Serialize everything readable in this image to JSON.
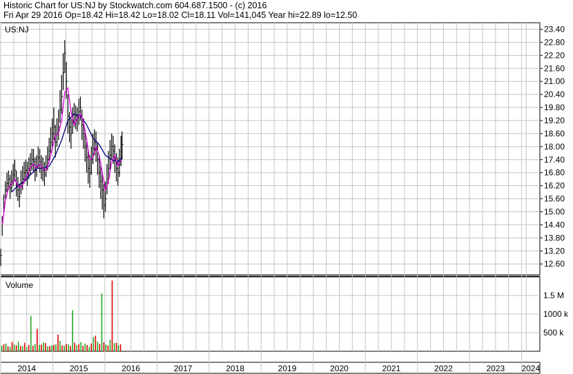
{
  "header": {
    "line1": "Historic Chart for US:NJ by Stockwatch.com 604.687.1500 - (c) 2016",
    "line2": "Fri Apr 29 2016   Op=18.42   Hi=18.42   Lo=18.02   Cl=18.11   Vol=141,045   Year hi=22.89   lo=12.50"
  },
  "colors": {
    "grid": "#c4c4c4",
    "price_bar": "#000000",
    "ma_short": "#dd00dd",
    "ma_long": "#000080",
    "volume_up": "#22aa22",
    "volume_down": "#dd0000"
  },
  "chart_data": [
    {
      "type": "line",
      "subtype": "ohlc-with-moving-averages",
      "title": "US:NJ",
      "y_ticks": [
        "23.40",
        "22.80",
        "22.20",
        "21.60",
        "21.00",
        "20.40",
        "19.80",
        "19.20",
        "18.60",
        "18.00",
        "17.40",
        "16.80",
        "16.20",
        "15.60",
        "15.00",
        "14.40",
        "13.80",
        "13.20",
        "12.60"
      ],
      "ylim": [
        12.1,
        23.7
      ],
      "xlim": [
        2014.0,
        2024.35
      ],
      "grid": true,
      "series": [
        {
          "style": "price-bars",
          "x": [
            2014.0,
            2014.03,
            2014.06,
            2014.09,
            2014.12,
            2014.15,
            2014.18,
            2014.21,
            2014.24,
            2014.27,
            2014.3,
            2014.33,
            2014.36,
            2014.39,
            2014.42,
            2014.45,
            2014.48,
            2014.51,
            2014.54,
            2014.57,
            2014.6,
            2014.63,
            2014.66,
            2014.69,
            2014.72,
            2014.75,
            2014.78,
            2014.81,
            2014.84,
            2014.87,
            2014.9,
            2014.93,
            2014.96,
            2014.99,
            2015.02,
            2015.05,
            2015.08,
            2015.11,
            2015.14,
            2015.17,
            2015.2,
            2015.23,
            2015.26,
            2015.29,
            2015.32,
            2015.35,
            2015.38,
            2015.41,
            2015.44,
            2015.47,
            2015.5,
            2015.53,
            2015.56,
            2015.59,
            2015.62,
            2015.65,
            2015.68,
            2015.71,
            2015.74,
            2015.77,
            2015.8,
            2015.83,
            2015.86,
            2015.89,
            2015.92,
            2015.95,
            2015.98,
            2016.01,
            2016.04,
            2016.07,
            2016.1,
            2016.13,
            2016.16,
            2016.19,
            2016.22,
            2016.25,
            2016.28,
            2016.31,
            2016.33
          ],
          "values": [
            13.0,
            14.5,
            15.4,
            16.0,
            16.3,
            16.5,
            16.1,
            16.4,
            16.7,
            16.9,
            16.2,
            16.0,
            15.7,
            16.3,
            16.5,
            16.8,
            16.9,
            16.7,
            17.0,
            17.2,
            17.4,
            17.3,
            16.9,
            17.1,
            17.5,
            17.3,
            17.0,
            16.9,
            16.7,
            17.1,
            17.4,
            17.8,
            18.2,
            18.6,
            18.9,
            18.2,
            18.6,
            18.9,
            19.7,
            20.3,
            21.4,
            22.3,
            21.0,
            19.4,
            18.9,
            18.6,
            19.2,
            19.5,
            19.4,
            19.3,
            19.6,
            19.8,
            19.0,
            18.6,
            18.0,
            17.5,
            17.0,
            16.8,
            17.4,
            17.9,
            18.2,
            18.0,
            17.4,
            16.8,
            16.4,
            16.0,
            15.3,
            15.6,
            16.5,
            17.0,
            17.6,
            18.0,
            17.8,
            17.4,
            17.0,
            16.8,
            17.2,
            17.8,
            18.1
          ],
          "high": [
            13.3,
            14.8,
            15.8,
            16.4,
            16.8,
            16.9,
            16.7,
            16.9,
            17.2,
            17.4,
            16.9,
            16.6,
            16.3,
            16.9,
            17.1,
            17.3,
            17.4,
            17.3,
            17.5,
            17.7,
            17.9,
            17.9,
            17.5,
            17.6,
            18.0,
            17.9,
            17.6,
            17.5,
            17.3,
            17.6,
            18.0,
            18.4,
            18.9,
            19.3,
            19.8,
            19.0,
            19.3,
            19.7,
            20.6,
            21.3,
            22.3,
            22.9,
            21.9,
            20.4,
            19.6,
            19.3,
            19.8,
            20.0,
            19.9,
            19.8,
            20.2,
            20.3,
            19.7,
            19.3,
            18.8,
            18.4,
            17.8,
            17.6,
            18.0,
            18.6,
            18.8,
            18.7,
            18.2,
            17.6,
            17.3,
            16.8,
            16.3,
            16.4,
            17.2,
            17.8,
            18.3,
            18.6,
            18.5,
            18.1,
            17.7,
            17.5,
            17.9,
            18.5,
            18.7
          ],
          "low": [
            12.5,
            13.9,
            15.0,
            15.6,
            15.9,
            16.0,
            15.6,
            15.9,
            16.2,
            16.4,
            15.7,
            15.5,
            15.2,
            15.8,
            16.0,
            16.3,
            16.4,
            16.2,
            16.5,
            16.7,
            16.9,
            16.8,
            16.4,
            16.6,
            17.0,
            16.8,
            16.5,
            16.4,
            16.2,
            16.6,
            16.9,
            17.3,
            17.6,
            18.0,
            18.3,
            17.5,
            18.0,
            18.3,
            19.1,
            19.5,
            20.6,
            21.4,
            20.2,
            18.6,
            18.2,
            17.9,
            18.6,
            18.9,
            18.8,
            18.7,
            19.0,
            19.2,
            18.3,
            17.9,
            17.3,
            16.8,
            16.3,
            16.1,
            16.7,
            17.2,
            17.6,
            17.3,
            16.7,
            16.1,
            15.6,
            15.1,
            14.7,
            15.0,
            15.8,
            16.3,
            16.9,
            17.4,
            17.2,
            16.8,
            16.4,
            16.2,
            16.6,
            17.1,
            17.4
          ]
        },
        {
          "style": "moving-average-short",
          "x": [
            2014.03,
            2014.09,
            2014.15,
            2014.21,
            2014.27,
            2014.33,
            2014.39,
            2014.45,
            2014.51,
            2014.57,
            2014.63,
            2014.69,
            2014.75,
            2014.81,
            2014.87,
            2014.93,
            2014.99,
            2015.05,
            2015.11,
            2015.17,
            2015.23,
            2015.29,
            2015.35,
            2015.41,
            2015.47,
            2015.53,
            2015.59,
            2015.65,
            2015.71,
            2015.77,
            2015.83,
            2015.89,
            2015.95,
            2016.01,
            2016.07,
            2016.13,
            2016.19,
            2016.25,
            2016.31
          ],
          "values": [
            14.4,
            15.5,
            16.1,
            16.3,
            16.5,
            16.2,
            16.1,
            16.4,
            16.7,
            17.0,
            17.2,
            17.0,
            17.2,
            17.0,
            16.9,
            17.3,
            17.9,
            18.5,
            18.6,
            19.2,
            20.5,
            20.7,
            19.6,
            19.0,
            19.3,
            19.5,
            19.1,
            18.3,
            17.4,
            17.5,
            18.0,
            17.6,
            16.8,
            16.0,
            16.4,
            17.3,
            17.6,
            17.1,
            17.4
          ]
        },
        {
          "style": "moving-average-long",
          "x": [
            2014.21,
            2014.33,
            2014.45,
            2014.57,
            2014.69,
            2014.81,
            2014.93,
            2015.05,
            2015.17,
            2015.29,
            2015.41,
            2015.53,
            2015.65,
            2015.77,
            2015.89,
            2016.01,
            2016.13,
            2016.25,
            2016.33
          ],
          "values": [
            15.9,
            16.2,
            16.4,
            16.7,
            17.0,
            17.0,
            17.1,
            17.6,
            18.3,
            19.2,
            19.5,
            19.4,
            19.0,
            18.4,
            18.1,
            17.6,
            17.4,
            17.3,
            17.5
          ]
        }
      ]
    },
    {
      "type": "bar",
      "title": "Volume",
      "y_ticks": [
        "1.5 M",
        "1000 k",
        "500 k"
      ],
      "y_tick_values": [
        1500000,
        1000000,
        500000
      ],
      "ylim": [
        0,
        2000000
      ],
      "xlim": [
        2014.0,
        2024.35
      ],
      "x_tick_labels": [
        "2014",
        "2015",
        "2016",
        "2017",
        "2018",
        "2019",
        "2020",
        "2021",
        "2022",
        "2023",
        "2024"
      ],
      "x_tick_values": [
        2014,
        2015,
        2016,
        2017,
        2018,
        2019,
        2020,
        2021,
        2022,
        2023,
        2024
      ],
      "grid": true,
      "up_x": [
        2014.02,
        2014.1,
        2014.18,
        2014.26,
        2014.34,
        2014.42,
        2014.5,
        2014.58,
        2014.66,
        2014.74,
        2014.82,
        2014.9,
        2014.98,
        2015.06,
        2015.14,
        2015.22,
        2015.3,
        2015.38,
        2015.46,
        2015.54,
        2015.62,
        2015.7,
        2015.78,
        2015.86,
        2015.94,
        2016.02,
        2016.1,
        2016.18,
        2016.26
      ],
      "up_values": [
        150000,
        210000,
        120000,
        180000,
        260000,
        140000,
        110000,
        950000,
        200000,
        170000,
        240000,
        130000,
        160000,
        190000,
        280000,
        150000,
        180000,
        1100000,
        170000,
        250000,
        210000,
        120000,
        380000,
        260000,
        1550000,
        180000,
        310000,
        220000,
        160000
      ],
      "down_x": [
        2014.06,
        2014.14,
        2014.22,
        2014.3,
        2014.38,
        2014.46,
        2014.54,
        2014.62,
        2014.7,
        2014.78,
        2014.86,
        2014.94,
        2015.02,
        2015.1,
        2015.18,
        2015.26,
        2015.34,
        2015.42,
        2015.5,
        2015.58,
        2015.66,
        2015.74,
        2015.82,
        2015.9,
        2015.98,
        2016.06,
        2016.14,
        2016.22,
        2016.3
      ],
      "down_values": [
        190000,
        130000,
        250000,
        160000,
        140000,
        230000,
        170000,
        150000,
        600000,
        180000,
        220000,
        140000,
        170000,
        450000,
        160000,
        200000,
        140000,
        230000,
        190000,
        150000,
        170000,
        210000,
        420000,
        200000,
        240000,
        160000,
        1900000,
        230000,
        190000
      ]
    }
  ]
}
